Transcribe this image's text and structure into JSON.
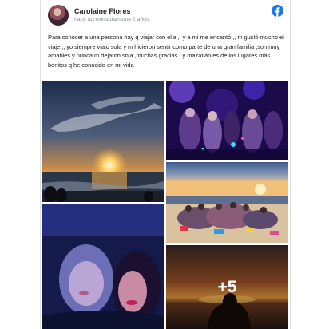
{
  "post": {
    "author": "Carolaine Flores",
    "timestamp": "hace aproximadamente 2 años",
    "text": "Para conocer a una persona hay q viajar con ella ,, y a mi me encantó ,, m gustó mucho el viaje ,, yo siempre viajo sola y m hicieron sentir como parte de una gran familia ,son muy amables y nunca m dejaron sola ,muchas gracias , y mazatlán es de los lugares más bonitos q he conocido en mi vida"
  },
  "brand": {
    "icon": "facebook-icon",
    "color": "#1877f2"
  },
  "photos": [
    {
      "icon": "sunset-beach-photo"
    },
    {
      "icon": "party-crowd-photo"
    },
    {
      "icon": "selfie-photo"
    },
    {
      "icon": "beach-group-photo"
    },
    {
      "icon": "sunset-silhouette-photo",
      "more_label": "+5"
    }
  ]
}
